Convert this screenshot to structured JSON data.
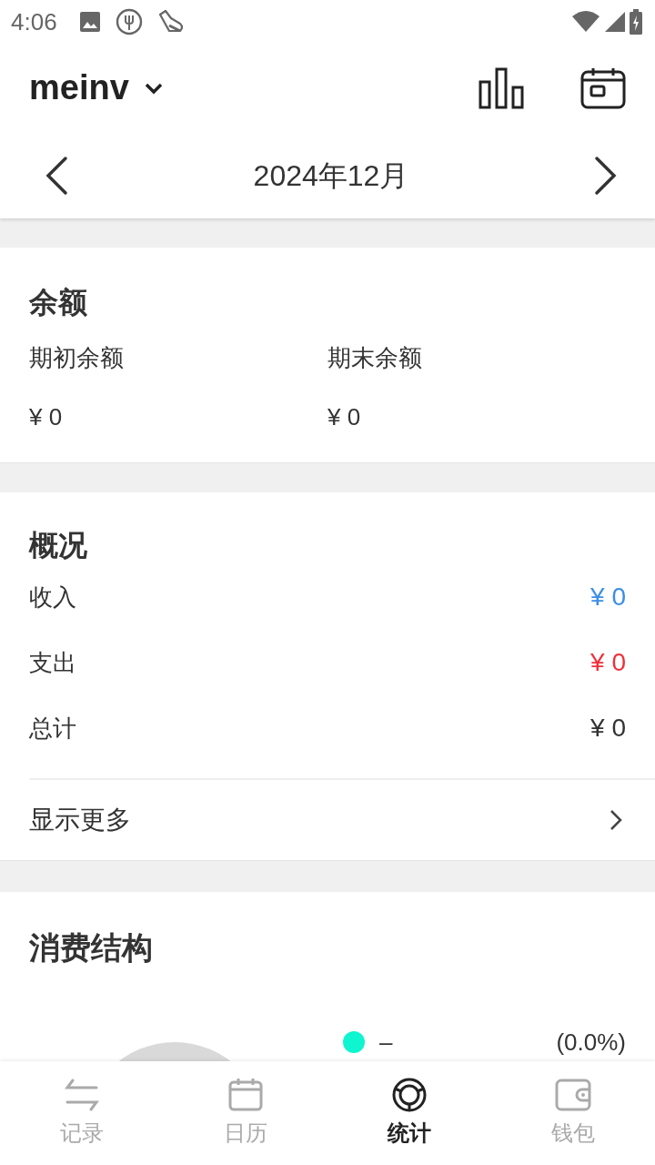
{
  "status_bar": {
    "time": "4:06"
  },
  "header": {
    "book": "meinv"
  },
  "month_nav": {
    "label": "2024年12月"
  },
  "balance": {
    "title": "余额",
    "items": [
      {
        "label": "期初余额",
        "value": "¥ 0"
      },
      {
        "label": "期末余额",
        "value": "¥ 0"
      }
    ]
  },
  "overview": {
    "title": "概况",
    "rows": [
      {
        "kind": "income",
        "label": "收入",
        "value": "¥ 0"
      },
      {
        "kind": "expense",
        "label": "支出",
        "value": "¥ 0"
      },
      {
        "kind": "total",
        "label": "总计",
        "value": "¥ 0"
      }
    ],
    "more": "显示更多"
  },
  "structure": {
    "title": "消费结构",
    "legend": [
      {
        "label": "–",
        "percent": "(0.0%)",
        "color": "#0ef5cf"
      }
    ]
  },
  "bottom_nav": [
    {
      "label": "记录",
      "selected": false
    },
    {
      "label": "日历",
      "selected": false
    },
    {
      "label": "统计",
      "selected": true
    },
    {
      "label": "钱包",
      "selected": false
    }
  ]
}
